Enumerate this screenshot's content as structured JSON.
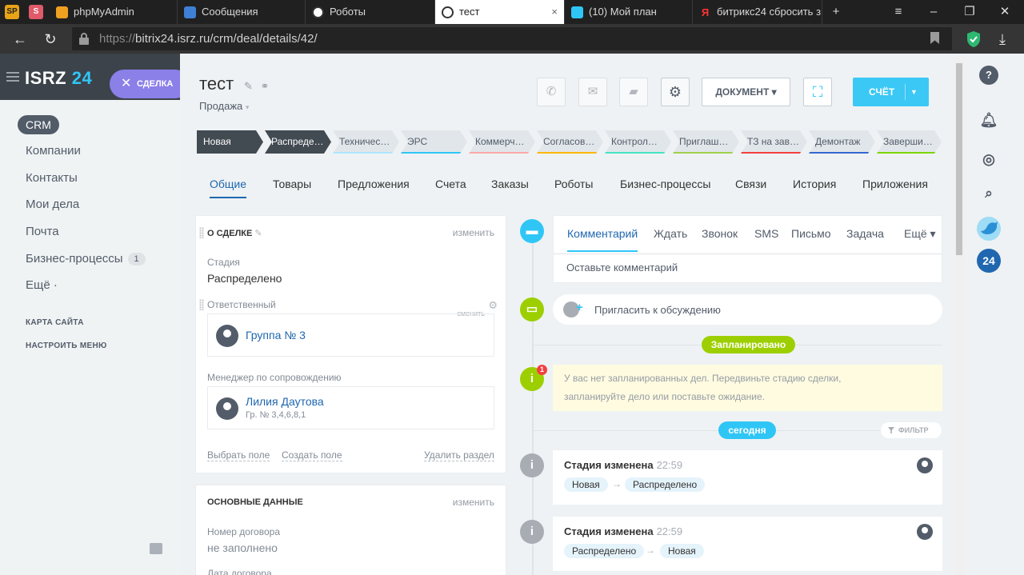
{
  "browser": {
    "pins": [
      "SP",
      "S"
    ],
    "tabs": [
      "phpMyAdmin",
      "Сообщения",
      "Роботы",
      "тест",
      "(10) Мой план",
      "битрикс24 сбросить з"
    ],
    "tab_close": "×",
    "new_tab": "+",
    "url_prefix": "https://",
    "url_rest": "bitrix24.isrz.ru/crm/deal/details/42/"
  },
  "leftnav": {
    "brand_name": "ISRZ",
    "brand_num": "24",
    "deal_pill": "СДЕЛКА",
    "crm": "CRM",
    "items": [
      "Компании",
      "Контакты",
      "Мои дела",
      "Почта",
      "Бизнес-процессы",
      "Ещё ·"
    ],
    "bp_badge": "1",
    "site_map": "КАРТА САЙТА",
    "configure_menu": "НАСТРОИТЬ МЕНЮ"
  },
  "deal": {
    "title": "тест",
    "subtitle": "Продажа",
    "document_btn": "ДОКУМЕНТ",
    "invoice_btn": "СЧЁТ"
  },
  "stages": [
    {
      "label": "Новая",
      "color": "#424a52"
    },
    {
      "label": "Распреде…",
      "color": "#424a52"
    },
    {
      "label": "Техничес…",
      "color": "#aee5ff"
    },
    {
      "label": "ЭРС",
      "color": "#2fc6f6"
    },
    {
      "label": "Коммерч…",
      "color": "#ffa8a8"
    },
    {
      "label": "Согласов…",
      "color": "#ffb700"
    },
    {
      "label": "Контрол…",
      "color": "#47e4c2"
    },
    {
      "label": "Приглаш…",
      "color": "#a1d04a"
    },
    {
      "label": "ТЗ на зав…",
      "color": "#f34040"
    },
    {
      "label": "Демонтаж",
      "color": "#3369d1"
    },
    {
      "label": "Заверши…",
      "color": "#7bd500"
    }
  ],
  "tabs": [
    "Общие",
    "Товары",
    "Предложения",
    "Счета",
    "Заказы",
    "Роботы",
    "Бизнес-процессы",
    "Связи",
    "История",
    "Приложения"
  ],
  "about": {
    "heading": "О СДЕЛКЕ",
    "edit": "изменить",
    "stage_label": "Стадия",
    "stage_value": "Распределено",
    "responsible_label": "Ответственный",
    "change": "сменить",
    "responsible_name": "Группа № 3",
    "manager_label": "Менеджер по сопровождению",
    "manager_name": "Лилия Даутова",
    "manager_sub": "Гр. № 3,4,6,8,1",
    "select_field": "Выбрать поле",
    "create_field": "Создать поле",
    "delete_section": "Удалить раздел"
  },
  "basic": {
    "heading": "ОСНОВНЫЕ ДАННЫЕ",
    "edit": "изменить",
    "contract_label": "Номер договора",
    "contract_value": "не заполнено",
    "date_label": "Дата договора"
  },
  "timeline": {
    "ctabs": [
      "Комментарий",
      "Ждать",
      "Звонок",
      "SMS",
      "Письмо",
      "Задача",
      "Ещё ▾"
    ],
    "comment_placeholder": "Оставьте комментарий",
    "invite": "Пригласить к обсуждению",
    "planned": "Запланировано",
    "notice_badge": "1",
    "notice_line1": "У вас нет запланированных дел. Передвиньте стадию сделки,",
    "notice_line2": "запланируйте дело или поставьте ожидание.",
    "today": "сегодня",
    "filter": "ФИЛЬТР",
    "events": [
      {
        "title": "Стадия изменена",
        "time": "22:59",
        "from": "Новая",
        "to": "Распределено"
      },
      {
        "title": "Стадия изменена",
        "time": "22:59",
        "from": "Распределено",
        "to": "Новая"
      }
    ]
  },
  "rightbar": {
    "b24": "24"
  }
}
